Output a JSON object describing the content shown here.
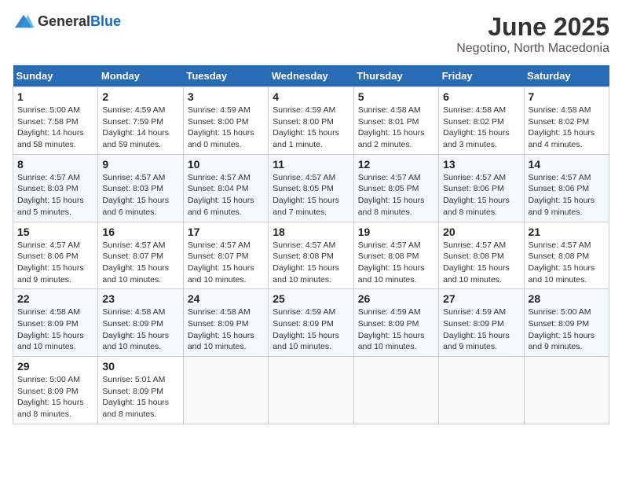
{
  "header": {
    "logo_general": "General",
    "logo_blue": "Blue",
    "title": "June 2025",
    "subtitle": "Negotino, North Macedonia"
  },
  "calendar": {
    "days_of_week": [
      "Sunday",
      "Monday",
      "Tuesday",
      "Wednesday",
      "Thursday",
      "Friday",
      "Saturday"
    ],
    "weeks": [
      [
        null,
        {
          "day": "2",
          "sunrise": "4:59 AM",
          "sunset": "7:59 PM",
          "daylight": "14 hours and 59 minutes."
        },
        {
          "day": "3",
          "sunrise": "4:59 AM",
          "sunset": "8:00 PM",
          "daylight": "15 hours and 0 minutes."
        },
        {
          "day": "4",
          "sunrise": "4:59 AM",
          "sunset": "8:00 PM",
          "daylight": "15 hours and 1 minute."
        },
        {
          "day": "5",
          "sunrise": "4:58 AM",
          "sunset": "8:01 PM",
          "daylight": "15 hours and 2 minutes."
        },
        {
          "day": "6",
          "sunrise": "4:58 AM",
          "sunset": "8:02 PM",
          "daylight": "15 hours and 3 minutes."
        },
        {
          "day": "7",
          "sunrise": "4:58 AM",
          "sunset": "8:02 PM",
          "daylight": "15 hours and 4 minutes."
        }
      ],
      [
        {
          "day": "1",
          "sunrise": "5:00 AM",
          "sunset": "7:58 PM",
          "daylight": "14 hours and 58 minutes."
        },
        null,
        null,
        null,
        null,
        null,
        null
      ],
      [
        {
          "day": "8",
          "sunrise": "4:57 AM",
          "sunset": "8:03 PM",
          "daylight": "15 hours and 5 minutes."
        },
        {
          "day": "9",
          "sunrise": "4:57 AM",
          "sunset": "8:03 PM",
          "daylight": "15 hours and 6 minutes."
        },
        {
          "day": "10",
          "sunrise": "4:57 AM",
          "sunset": "8:04 PM",
          "daylight": "15 hours and 6 minutes."
        },
        {
          "day": "11",
          "sunrise": "4:57 AM",
          "sunset": "8:05 PM",
          "daylight": "15 hours and 7 minutes."
        },
        {
          "day": "12",
          "sunrise": "4:57 AM",
          "sunset": "8:05 PM",
          "daylight": "15 hours and 8 minutes."
        },
        {
          "day": "13",
          "sunrise": "4:57 AM",
          "sunset": "8:06 PM",
          "daylight": "15 hours and 8 minutes."
        },
        {
          "day": "14",
          "sunrise": "4:57 AM",
          "sunset": "8:06 PM",
          "daylight": "15 hours and 9 minutes."
        }
      ],
      [
        {
          "day": "15",
          "sunrise": "4:57 AM",
          "sunset": "8:06 PM",
          "daylight": "15 hours and 9 minutes."
        },
        {
          "day": "16",
          "sunrise": "4:57 AM",
          "sunset": "8:07 PM",
          "daylight": "15 hours and 10 minutes."
        },
        {
          "day": "17",
          "sunrise": "4:57 AM",
          "sunset": "8:07 PM",
          "daylight": "15 hours and 10 minutes."
        },
        {
          "day": "18",
          "sunrise": "4:57 AM",
          "sunset": "8:08 PM",
          "daylight": "15 hours and 10 minutes."
        },
        {
          "day": "19",
          "sunrise": "4:57 AM",
          "sunset": "8:08 PM",
          "daylight": "15 hours and 10 minutes."
        },
        {
          "day": "20",
          "sunrise": "4:57 AM",
          "sunset": "8:08 PM",
          "daylight": "15 hours and 10 minutes."
        },
        {
          "day": "21",
          "sunrise": "4:57 AM",
          "sunset": "8:08 PM",
          "daylight": "15 hours and 10 minutes."
        }
      ],
      [
        {
          "day": "22",
          "sunrise": "4:58 AM",
          "sunset": "8:09 PM",
          "daylight": "15 hours and 10 minutes."
        },
        {
          "day": "23",
          "sunrise": "4:58 AM",
          "sunset": "8:09 PM",
          "daylight": "15 hours and 10 minutes."
        },
        {
          "day": "24",
          "sunrise": "4:58 AM",
          "sunset": "8:09 PM",
          "daylight": "15 hours and 10 minutes."
        },
        {
          "day": "25",
          "sunrise": "4:59 AM",
          "sunset": "8:09 PM",
          "daylight": "15 hours and 10 minutes."
        },
        {
          "day": "26",
          "sunrise": "4:59 AM",
          "sunset": "8:09 PM",
          "daylight": "15 hours and 10 minutes."
        },
        {
          "day": "27",
          "sunrise": "4:59 AM",
          "sunset": "8:09 PM",
          "daylight": "15 hours and 9 minutes."
        },
        {
          "day": "28",
          "sunrise": "5:00 AM",
          "sunset": "8:09 PM",
          "daylight": "15 hours and 9 minutes."
        }
      ],
      [
        {
          "day": "29",
          "sunrise": "5:00 AM",
          "sunset": "8:09 PM",
          "daylight": "15 hours and 8 minutes."
        },
        {
          "day": "30",
          "sunrise": "5:01 AM",
          "sunset": "8:09 PM",
          "daylight": "15 hours and 8 minutes."
        },
        null,
        null,
        null,
        null,
        null
      ]
    ]
  }
}
